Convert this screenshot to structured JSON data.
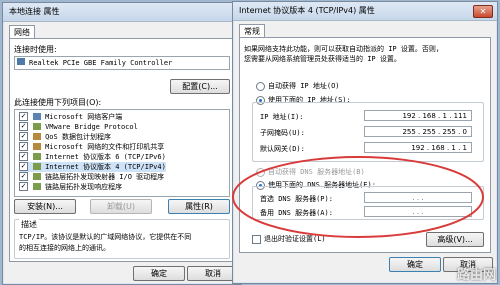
{
  "left_window": {
    "title": "本地连接 属性",
    "tab": "网络",
    "connect_using_label": "连接时使用:",
    "adapter": "Realtek PCIe GBE Family Controller",
    "configure_button": "配置(C)...",
    "items_label": "此连接使用下列项目(O):",
    "items": [
      {
        "label": "Microsoft 网络客户端",
        "checked": true
      },
      {
        "label": "VMware Bridge Protocol",
        "checked": true
      },
      {
        "label": "QoS 数据包计划程序",
        "checked": true
      },
      {
        "label": "Microsoft 网络的文件和打印机共享",
        "checked": true
      },
      {
        "label": "Internet 协议版本 6 (TCP/IPv6)",
        "checked": true
      },
      {
        "label": "Internet 协议版本 4 (TCP/IPv4)",
        "checked": true
      },
      {
        "label": "链路层拓扑发现映射器 I/O 驱动程序",
        "checked": true
      },
      {
        "label": "链路层拓扑发现响应程序",
        "checked": true
      }
    ],
    "install_button": "安装(N)...",
    "uninstall_button": "卸载(U)",
    "properties_button": "属性(R)",
    "description_label": "描述",
    "description_text_1": "TCP/IP。该协议是默认的广域网络协议，它提供在不同",
    "description_text_2": "的相互连接的网络上的通讯。",
    "ok_button": "确定",
    "cancel_button": "取消"
  },
  "right_window": {
    "title": "Internet 协议版本 4 (TCP/IPv4) 属性",
    "close_symbol": "✕",
    "tab": "常规",
    "intro_1": "如果网络支持此功能，则可以获取自动指派的 IP 设置。否则，",
    "intro_2": "您需要从网络系统管理员处获得适当的 IP 设置。",
    "auto_ip_label": "自动获得 IP 地址(O)",
    "manual_ip_label": "使用下面的 IP 地址(S):",
    "ip_address_label": "IP 地址(I):",
    "ip_address_value": "192 . 168 . 1 . 111",
    "subnet_label": "子网掩码(U):",
    "subnet_value": "255 . 255 . 255 . 0",
    "gateway_label": "默认网关(D):",
    "gateway_value": "192 . 168 . 1 . 1",
    "auto_dns_label": "自动获得 DNS 服务器地址(B)",
    "manual_dns_label": "使用下面的 DNS 服务器地址(E):",
    "preferred_dns_label": "首选 DNS 服务器(P):",
    "alternate_dns_label": "备用 DNS 服务器(A):",
    "dns_placeholder": ".   .   .",
    "validate_label": "退出时验证设置(L)",
    "advanced_button": "高级(V)...",
    "ok_button": "确定",
    "cancel_button": "取消"
  },
  "watermark": "路由网",
  "colors": {
    "highlight_circle": "#d93a3a",
    "radio_selected": "#1f6fd0"
  }
}
